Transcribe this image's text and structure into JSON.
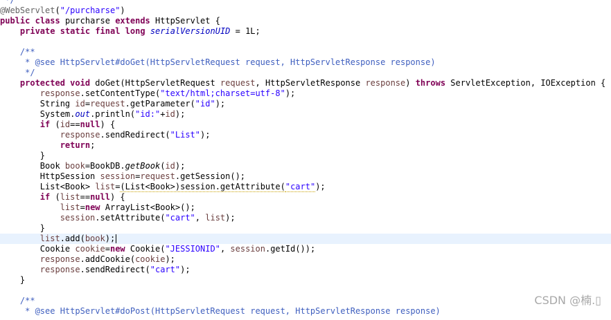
{
  "code_lines": [
    [
      {
        "t": " */",
        "c": "cm"
      }
    ],
    [
      {
        "t": "@WebServlet",
        "c": "an"
      },
      {
        "t": "("
      },
      {
        "t": "\"/purcharse\"",
        "c": "str"
      },
      {
        "t": ")"
      }
    ],
    [
      {
        "t": "public",
        "c": "kw"
      },
      {
        "t": " "
      },
      {
        "t": "class",
        "c": "kw"
      },
      {
        "t": " purcharse "
      },
      {
        "t": "extends",
        "c": "kw"
      },
      {
        "t": " HttpServlet {"
      }
    ],
    [
      {
        "t": "    "
      },
      {
        "t": "private",
        "c": "kw"
      },
      {
        "t": " "
      },
      {
        "t": "static",
        "c": "kw"
      },
      {
        "t": " "
      },
      {
        "t": "final",
        "c": "kw"
      },
      {
        "t": " "
      },
      {
        "t": "long",
        "c": "kw"
      },
      {
        "t": " "
      },
      {
        "t": "serialVersionUID",
        "c": "fld"
      },
      {
        "t": " = 1L;"
      }
    ],
    [],
    [
      {
        "t": "    /**",
        "c": "cm"
      }
    ],
    [
      {
        "t": "     * @see HttpServlet#doGet(HttpServletRequest request, HttpServletResponse response)",
        "c": "cm"
      }
    ],
    [
      {
        "t": "     */",
        "c": "cm"
      }
    ],
    [
      {
        "t": "    "
      },
      {
        "t": "protected",
        "c": "kw"
      },
      {
        "t": " "
      },
      {
        "t": "void",
        "c": "kw"
      },
      {
        "t": " doGet(HttpServletRequest "
      },
      {
        "t": "request",
        "c": "lv"
      },
      {
        "t": ", HttpServletResponse "
      },
      {
        "t": "response",
        "c": "lv"
      },
      {
        "t": ") "
      },
      {
        "t": "throws",
        "c": "kw"
      },
      {
        "t": " ServletException, IOException {"
      }
    ],
    [
      {
        "t": "        "
      },
      {
        "t": "response",
        "c": "lv"
      },
      {
        "t": ".setContentType("
      },
      {
        "t": "\"text/html;charset=utf-8\"",
        "c": "str"
      },
      {
        "t": ");"
      }
    ],
    [
      {
        "t": "        String "
      },
      {
        "t": "id",
        "c": "lv"
      },
      {
        "t": "="
      },
      {
        "t": "request",
        "c": "lv"
      },
      {
        "t": ".getParameter("
      },
      {
        "t": "\"id\"",
        "c": "str"
      },
      {
        "t": ");"
      }
    ],
    [
      {
        "t": "        System."
      },
      {
        "t": "out",
        "c": "fld"
      },
      {
        "t": ".println("
      },
      {
        "t": "\"id:\"",
        "c": "str"
      },
      {
        "t": "+"
      },
      {
        "t": "id",
        "c": "lv"
      },
      {
        "t": ");"
      }
    ],
    [
      {
        "t": "        "
      },
      {
        "t": "if",
        "c": "kw"
      },
      {
        "t": " ("
      },
      {
        "t": "id",
        "c": "lv"
      },
      {
        "t": "=="
      },
      {
        "t": "null",
        "c": "kw"
      },
      {
        "t": ") {"
      }
    ],
    [
      {
        "t": "            "
      },
      {
        "t": "response",
        "c": "lv"
      },
      {
        "t": ".sendRedirect("
      },
      {
        "t": "\"List\"",
        "c": "str"
      },
      {
        "t": ");"
      }
    ],
    [
      {
        "t": "            "
      },
      {
        "t": "return",
        "c": "kw"
      },
      {
        "t": ";"
      }
    ],
    [
      {
        "t": "        }"
      }
    ],
    [
      {
        "t": "        Book "
      },
      {
        "t": "book",
        "c": "lv"
      },
      {
        "t": "=BookDB."
      },
      {
        "t": "getBook",
        "c": "ital"
      },
      {
        "t": "("
      },
      {
        "t": "id",
        "c": "lv"
      },
      {
        "t": ");"
      }
    ],
    [
      {
        "t": "        HttpSession "
      },
      {
        "t": "session",
        "c": "lv"
      },
      {
        "t": "="
      },
      {
        "t": "request",
        "c": "lv"
      },
      {
        "t": ".getSession();"
      }
    ],
    [
      {
        "t": "        List<Book> "
      },
      {
        "t": "list",
        "c": "lv"
      },
      {
        "t": "="
      },
      {
        "t": "(List<Book>)session.getAttribute(",
        "c": "warn"
      },
      {
        "t": "\"cart\"",
        "c": "str warn"
      },
      {
        "t": ");"
      }
    ],
    [
      {
        "t": "        "
      },
      {
        "t": "if",
        "c": "kw"
      },
      {
        "t": " ("
      },
      {
        "t": "list",
        "c": "lv"
      },
      {
        "t": "=="
      },
      {
        "t": "null",
        "c": "kw"
      },
      {
        "t": ") {"
      }
    ],
    [
      {
        "t": "            "
      },
      {
        "t": "list",
        "c": "lv"
      },
      {
        "t": "="
      },
      {
        "t": "new",
        "c": "kw"
      },
      {
        "t": " ArrayList<Book>();"
      }
    ],
    [
      {
        "t": "            "
      },
      {
        "t": "session",
        "c": "lv"
      },
      {
        "t": ".setAttribute("
      },
      {
        "t": "\"cart\"",
        "c": "str"
      },
      {
        "t": ", "
      },
      {
        "t": "list",
        "c": "lv"
      },
      {
        "t": ");"
      }
    ],
    [
      {
        "t": "        }"
      }
    ],
    [
      {
        "t": "        "
      },
      {
        "t": "list",
        "c": "lv"
      },
      {
        "t": ".add("
      },
      {
        "t": "book",
        "c": "lv"
      },
      {
        "t": ");"
      }
    ],
    [
      {
        "t": "        Cookie "
      },
      {
        "t": "cookie",
        "c": "lv"
      },
      {
        "t": "="
      },
      {
        "t": "new",
        "c": "kw"
      },
      {
        "t": " Cookie("
      },
      {
        "t": "\"JESSIONID\"",
        "c": "str"
      },
      {
        "t": ", "
      },
      {
        "t": "session",
        "c": "lv"
      },
      {
        "t": ".getId());"
      }
    ],
    [
      {
        "t": "        "
      },
      {
        "t": "response",
        "c": "lv"
      },
      {
        "t": ".addCookie("
      },
      {
        "t": "cookie",
        "c": "lv"
      },
      {
        "t": ");"
      }
    ],
    [
      {
        "t": "        "
      },
      {
        "t": "response",
        "c": "lv"
      },
      {
        "t": ".sendRedirect("
      },
      {
        "t": "\"cart\"",
        "c": "str"
      },
      {
        "t": ");"
      }
    ],
    [
      {
        "t": "    }"
      }
    ],
    [],
    [
      {
        "t": "    /**",
        "c": "cm"
      }
    ],
    [
      {
        "t": "     * @see HttpServlet#doPost(HttpServletRequest request, HttpServletResponse response)",
        "c": "cm"
      }
    ]
  ],
  "cursor_line": 23,
  "watermark": "CSDN @楠.▯",
  "colors": {
    "keyword": "#7f0055",
    "comment": "#3f5fbf",
    "string": "#2a00ff",
    "field": "#0000c0",
    "local_variable": "#6a3e3e",
    "annotation": "#646464",
    "current_line": "#e8f2fe",
    "background": "#ffffff"
  }
}
